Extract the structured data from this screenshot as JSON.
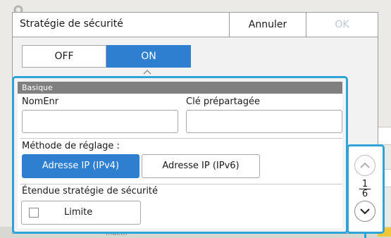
{
  "dialog": {
    "title": "Stratégie de sécurité",
    "cancel_label": "Annuler",
    "ok_label": "OK"
  },
  "toggle": {
    "off_label": "OFF",
    "on_label": "ON",
    "selected": "ON"
  },
  "section": {
    "title": "Basique"
  },
  "fields": {
    "nomenr_label": "NomEnr",
    "nomenr_value": "",
    "cle_label": "Clé prépartagée",
    "cle_value": ""
  },
  "method": {
    "label": "Méthode de réglage :",
    "options": [
      "Adresse IP (IPv4)",
      "Adresse IP (IPv6)"
    ],
    "selected": "Adresse IP (IPv4)"
  },
  "scope": {
    "label": "Étendue stratégie de sécurité",
    "limit_label": "Limite",
    "limit_checked": false
  },
  "pager": {
    "current": "1",
    "total": "6"
  },
  "colors": {
    "accent": "#2f7fd0",
    "highlight": "#2ea3d8",
    "section_head": "#7f7f7f"
  },
  "background": {
    "bottom_text": "Inactif"
  }
}
